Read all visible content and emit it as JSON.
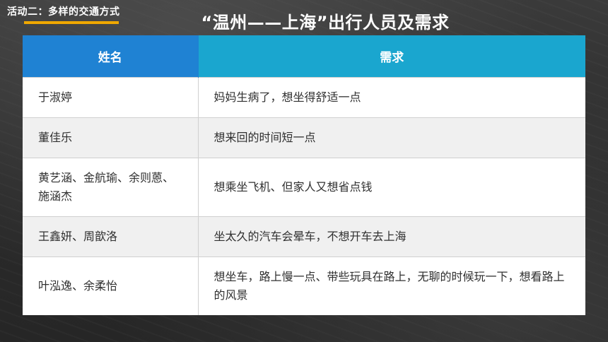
{
  "activity": {
    "label": "活动二：多样的交通方式"
  },
  "title": "“温州——上海”出行人员及需求",
  "table": {
    "headers": [
      "姓名",
      "需求"
    ],
    "rows": [
      {
        "name": "于淑婷",
        "need": "妈妈生病了，想坐得舒适一点"
      },
      {
        "name": "董佳乐",
        "need": "想来回的时间短一点"
      },
      {
        "name": "黄艺涵、金航瑜、余则蒽、施涵杰",
        "need": "想乘坐飞机、但家人又想省点钱"
      },
      {
        "name": "王鑫妍、周歆洛",
        "need": "坐太久的汽车会晕车，不想开车去上海"
      },
      {
        "name": "叶泓逸、余柔怡",
        "need": "想坐车，路上慢一点、带些玩具在路上，无聊的时候玩一下，想看路上的风景"
      }
    ]
  },
  "colors": {
    "header_name_bg": "#1f82d3",
    "header_need_bg": "#1aa6cf",
    "accent_underline": "#f0a800"
  }
}
